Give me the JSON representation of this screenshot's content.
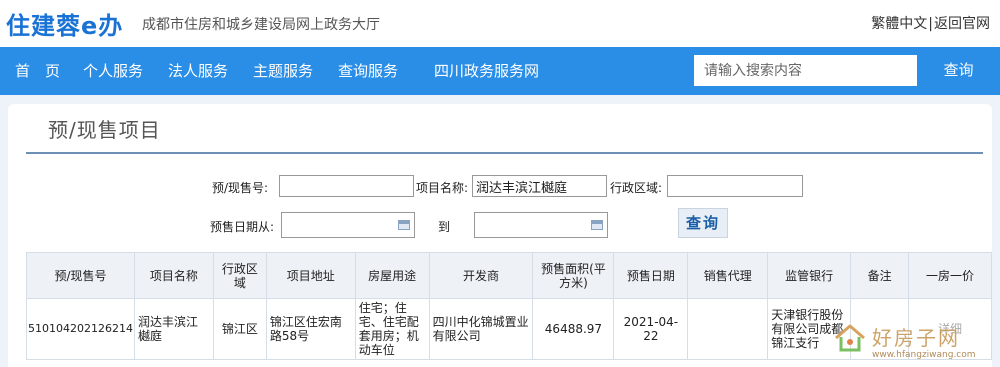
{
  "header": {
    "logo": "住建蓉e办",
    "subtitle": "成都市住房和城乡建设局网上政务大厅",
    "link_traditional": "繁體中文",
    "link_separator": "|",
    "link_back": "返回官网"
  },
  "nav": {
    "items": [
      {
        "label": "首　页"
      },
      {
        "label": "个人服务"
      },
      {
        "label": "法人服务"
      },
      {
        "label": "主题服务"
      },
      {
        "label": "查询服务"
      },
      {
        "label": "四川政务服务网"
      }
    ],
    "search_placeholder": "请输入搜索内容",
    "search_button": "查询"
  },
  "page": {
    "title": "预/现售项目"
  },
  "filters": {
    "presale_no_label": "预/现售号:",
    "presale_no_value": "",
    "project_name_label": "项目名称:",
    "project_name_value": "润达丰滨江樾庭",
    "district_label": "行政区域:",
    "district_value": "",
    "date_from_label": "预售日期从:",
    "date_from_value": "",
    "date_to_label": "到",
    "date_to_value": "",
    "query_button": "查询"
  },
  "table": {
    "headers": [
      "预/现售号",
      "项目名称",
      "行政区域",
      "项目地址",
      "房屋用途",
      "开发商",
      "预售面积(平方米)",
      "预售日期",
      "销售代理",
      "监管银行",
      "备注",
      "一房一价"
    ],
    "rows": [
      {
        "presale_no": "510104202126214",
        "project_name": "润达丰滨江樾庭",
        "district": "锦江区",
        "address": "锦江区住宏南路58号",
        "usage": "住宅；住宅、住宅配套用房；机动车位",
        "developer": "四川中化锦城置业有限公司",
        "area": "46488.97",
        "date": "2021-04-22",
        "agent": "",
        "bank": "天津银行股份有限公司成都锦江支行",
        "remark": "",
        "price_link": "详细"
      }
    ]
  },
  "watermark": {
    "name": "好房子网",
    "url": "www.hfangziwang.com"
  },
  "colors": {
    "nav_blue": "#2b8ee6",
    "logo_blue": "#1a72d4",
    "page_bg": "#eef3f9"
  }
}
